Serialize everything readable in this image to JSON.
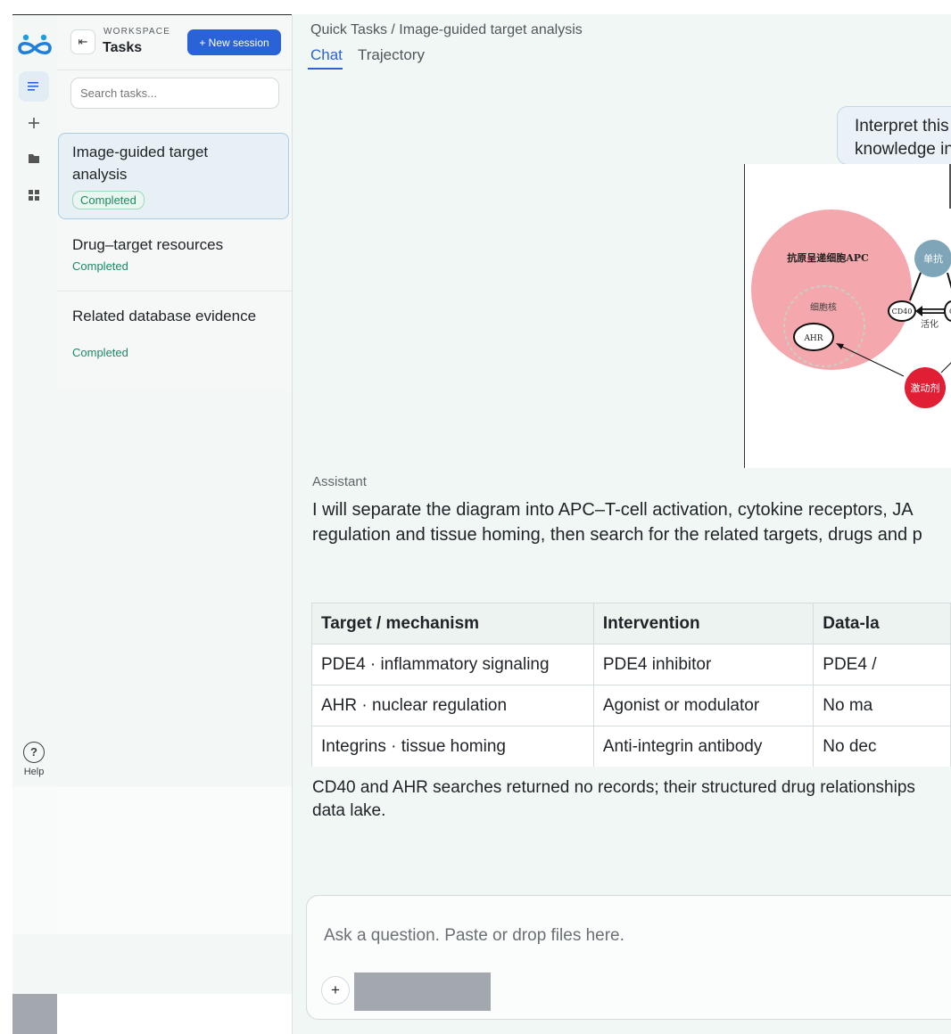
{
  "sidebar": {
    "workspace_label": "WORKSPACE",
    "title": "Tasks",
    "new_button": "+ New session",
    "search_placeholder": "Search tasks...",
    "help_label": "Help",
    "tasks": [
      {
        "title": "Image-guided target analysis",
        "status": "Completed",
        "active": true
      },
      {
        "title": "Drug–target resources",
        "status": "Completed",
        "active": false
      },
      {
        "title": "Related database evidence",
        "status": "Completed",
        "active": false
      }
    ]
  },
  "main": {
    "breadcrumb": "Quick Tasks / Image-guided target analysis",
    "tabs": [
      "Chat",
      "Trajectory"
    ],
    "active_tab": "Chat",
    "user_message": [
      "Interpret this",
      "knowledge in"
    ],
    "diagram": {
      "apc_label": "抗原呈递细胞APC",
      "nucleus_label": "细胞核",
      "ahr_label": "AHR",
      "mab_label": "单抗",
      "cd40_label": "CD40",
      "cd_label": "CD",
      "activation_label": "活化",
      "agonist_label": "激动剂"
    },
    "assistant_label": "Assistant",
    "assistant_text": [
      "I will separate the diagram into APC–T-cell activation, cytokine receptors, JA",
      "regulation and tissue homing, then search for the related targets, drugs and p"
    ],
    "table": {
      "headers": [
        "Target / mechanism",
        "Intervention",
        "Data-la"
      ],
      "rows": [
        [
          "PDE4 · inflammatory signaling",
          "PDE4 inhibitor",
          "PDE4 /"
        ],
        [
          "AHR · nuclear regulation",
          "Agonist or modulator",
          "No ma"
        ],
        [
          "Integrins · tissue homing",
          "Anti-integrin antibody",
          "No dec"
        ]
      ]
    },
    "note": [
      "CD40 and AHR searches returned no records; their structured drug relationships",
      "data lake."
    ],
    "composer_placeholder": "Ask a question. Paste or drop files here.",
    "attach_label": "+"
  },
  "colors": {
    "accent": "#2a63d8",
    "status_green": "#1c8a63",
    "apc_pink": "#f4a7ac",
    "agonist_red": "#e01f34",
    "mab_blue": "#7fa6b8"
  },
  "icons": [
    "infinity-logo-icon",
    "list-icon",
    "plus-icon",
    "folder-icon",
    "grid-icon",
    "help-icon",
    "collapse-sidebar-icon"
  ]
}
